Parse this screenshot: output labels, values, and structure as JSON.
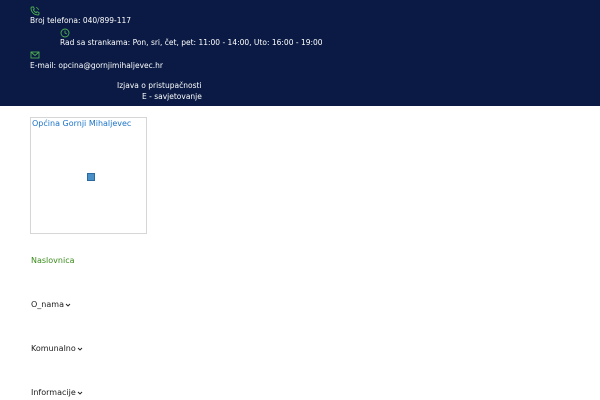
{
  "topbar": {
    "background": "#0a1a44",
    "icon_color": "#4caf50",
    "phone": {
      "icon": "phone-icon",
      "text": "Broj telefona: 040/899-117"
    },
    "hours": {
      "icon": "clock-icon",
      "text": "Rad sa strankama: Pon, sri, čet, pet: 11:00 - 14:00, Uto: 16:00 - 19:00"
    },
    "email": {
      "icon": "mail-icon",
      "text": "E-mail: opcina@gornjimihaljevec.hr"
    },
    "links": {
      "accessibility": "Izjava o pristupačnosti",
      "consultation": "E - savjetovanje"
    }
  },
  "logo": {
    "alt_text": "Općina Gornji Mihaljevec",
    "color": "#1a73c8"
  },
  "nav": {
    "active_color": "#3a8a1a",
    "items": [
      {
        "label": "Naslovnica",
        "active": true,
        "has_dropdown": false
      },
      {
        "label": "O_nama",
        "active": false,
        "has_dropdown": true
      },
      {
        "label": "Komunalno",
        "active": false,
        "has_dropdown": true
      },
      {
        "label": "Informacije",
        "active": false,
        "has_dropdown": true
      }
    ]
  }
}
